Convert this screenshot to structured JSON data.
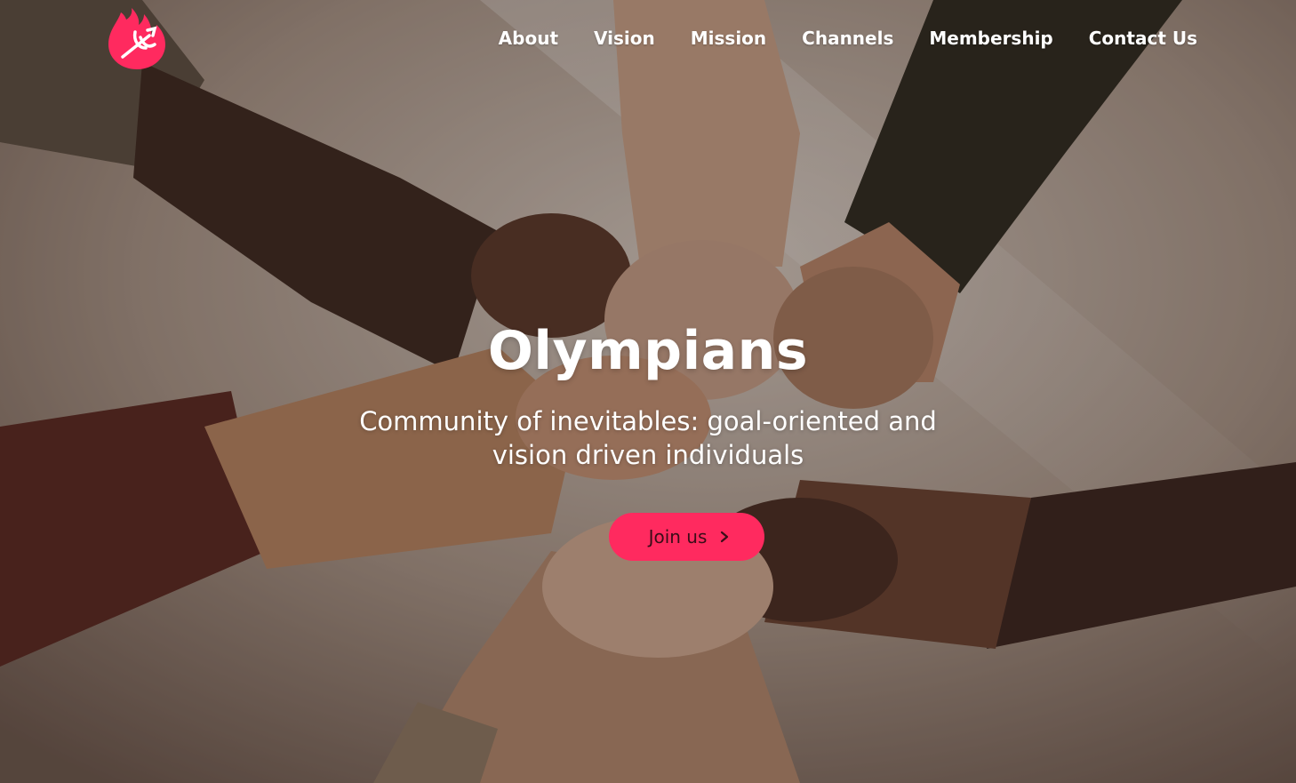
{
  "brand": {
    "logo_icon": "flame-trident-icon",
    "accent_color": "#ff2a5f"
  },
  "nav": {
    "items": [
      {
        "label": "About"
      },
      {
        "label": "Vision"
      },
      {
        "label": "Mission"
      },
      {
        "label": "Channels"
      },
      {
        "label": "Membership"
      },
      {
        "label": "Contact Us"
      }
    ]
  },
  "hero": {
    "background": "hands-fist-bump-photo",
    "title": "Olympians",
    "subtitle": "Community of inevitables: goal-oriented and vision driven individuals",
    "cta_label": "Join us",
    "cta_icon": "chevron-right-icon"
  }
}
